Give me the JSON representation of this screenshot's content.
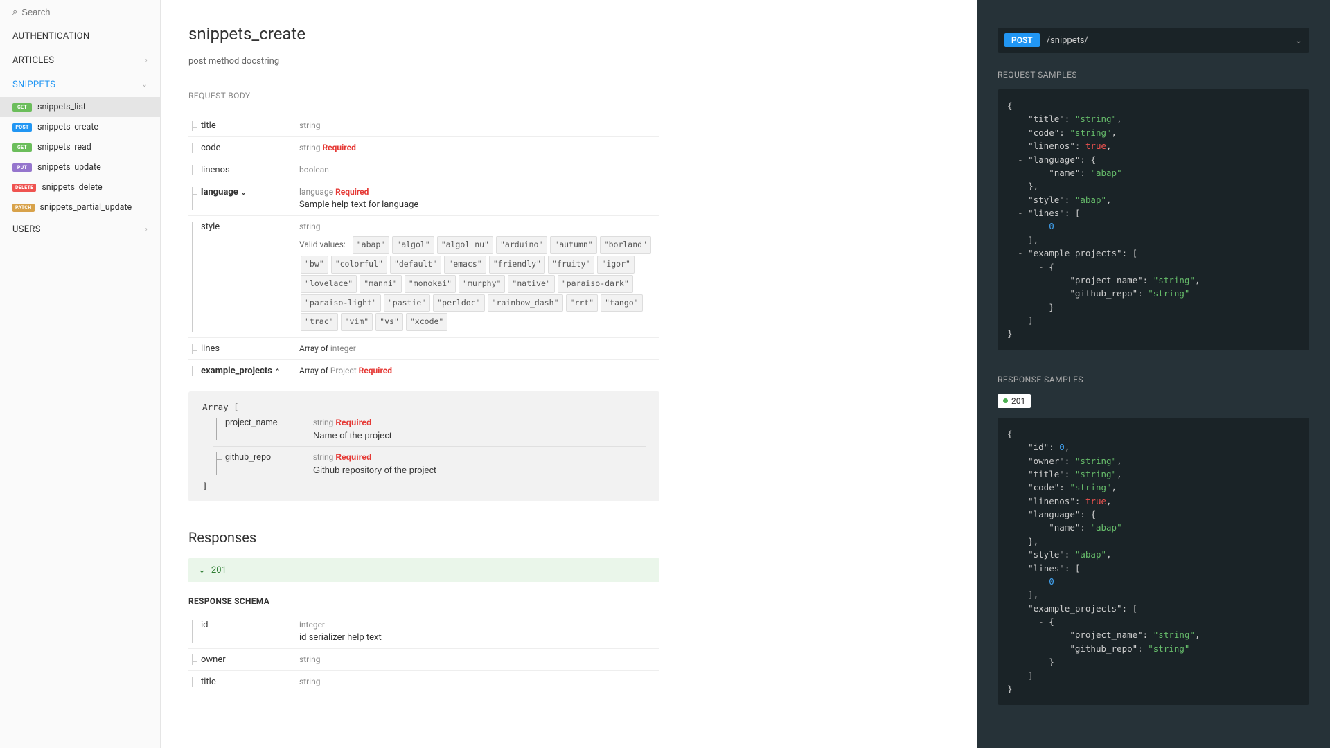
{
  "sidebar": {
    "search_placeholder": "Search",
    "items": [
      {
        "label": "AUTHENTICATION",
        "expandable": false
      },
      {
        "label": "ARTICLES",
        "expandable": true
      },
      {
        "label": "SNIPPETS",
        "expandable": true,
        "active": true
      },
      {
        "label": "USERS",
        "expandable": true
      }
    ],
    "snippets": [
      {
        "method": "GET",
        "label": "snippets_list",
        "method_class": "method-get",
        "active_bg": true
      },
      {
        "method": "POST",
        "label": "snippets_create",
        "method_class": "method-post"
      },
      {
        "method": "GET",
        "label": "snippets_read",
        "method_class": "method-get"
      },
      {
        "method": "PUT",
        "label": "snippets_update",
        "method_class": "method-put"
      },
      {
        "method": "DELETE",
        "label": "snippets_delete",
        "method_class": "method-delete"
      },
      {
        "method": "PATCH",
        "label": "snippets_partial_update",
        "method_class": "method-patch"
      }
    ]
  },
  "main": {
    "title": "snippets_create",
    "subtitle": "post method docstring",
    "request_body_h": "REQUEST BODY",
    "responses_h": "Responses",
    "response_schema_h": "RESPONSE SCHEMA",
    "response_code": "201",
    "required_label": "Required",
    "params": {
      "title": {
        "name": "title",
        "type": "string"
      },
      "code": {
        "name": "code",
        "type": "string",
        "required": true
      },
      "linenos": {
        "name": "linenos",
        "type": "boolean"
      },
      "language": {
        "name": "language",
        "type": "language",
        "required": true,
        "desc": "Sample help text for language"
      },
      "style": {
        "name": "style",
        "type": "string"
      },
      "lines": {
        "name": "lines",
        "type_prefix": "Array of ",
        "type": "integer"
      },
      "example_projects": {
        "name": "example_projects",
        "type_prefix": "Array of ",
        "type": "Project",
        "required": true
      }
    },
    "valid_values_label": "Valid values:",
    "style_enum": [
      "abap",
      "algol",
      "algol_nu",
      "arduino",
      "autumn",
      "borland",
      "bw",
      "colorful",
      "default",
      "emacs",
      "friendly",
      "fruity",
      "igor",
      "lovelace",
      "manni",
      "monokai",
      "murphy",
      "native",
      "paraiso-dark",
      "paraiso-light",
      "pastie",
      "perldoc",
      "rainbow_dash",
      "rrt",
      "tango",
      "trac",
      "vim",
      "vs",
      "xcode"
    ],
    "nested": {
      "array_open": "Array [",
      "array_close": "]",
      "project_name": {
        "name": "project_name",
        "type": "string",
        "required": true,
        "desc": "Name of the project"
      },
      "github_repo": {
        "name": "github_repo",
        "type": "string",
        "required": true,
        "desc": "Github repository of the project"
      }
    },
    "schema_params": {
      "id": {
        "name": "id",
        "type": "integer",
        "desc": "id serializer help text"
      },
      "owner": {
        "name": "owner",
        "type": "string"
      },
      "title": {
        "name": "title",
        "type": "string"
      }
    }
  },
  "right": {
    "method": "POST",
    "path": "/snippets/",
    "request_h": "REQUEST SAMPLES",
    "response_h": "RESPONSE SAMPLES",
    "status": "201"
  }
}
